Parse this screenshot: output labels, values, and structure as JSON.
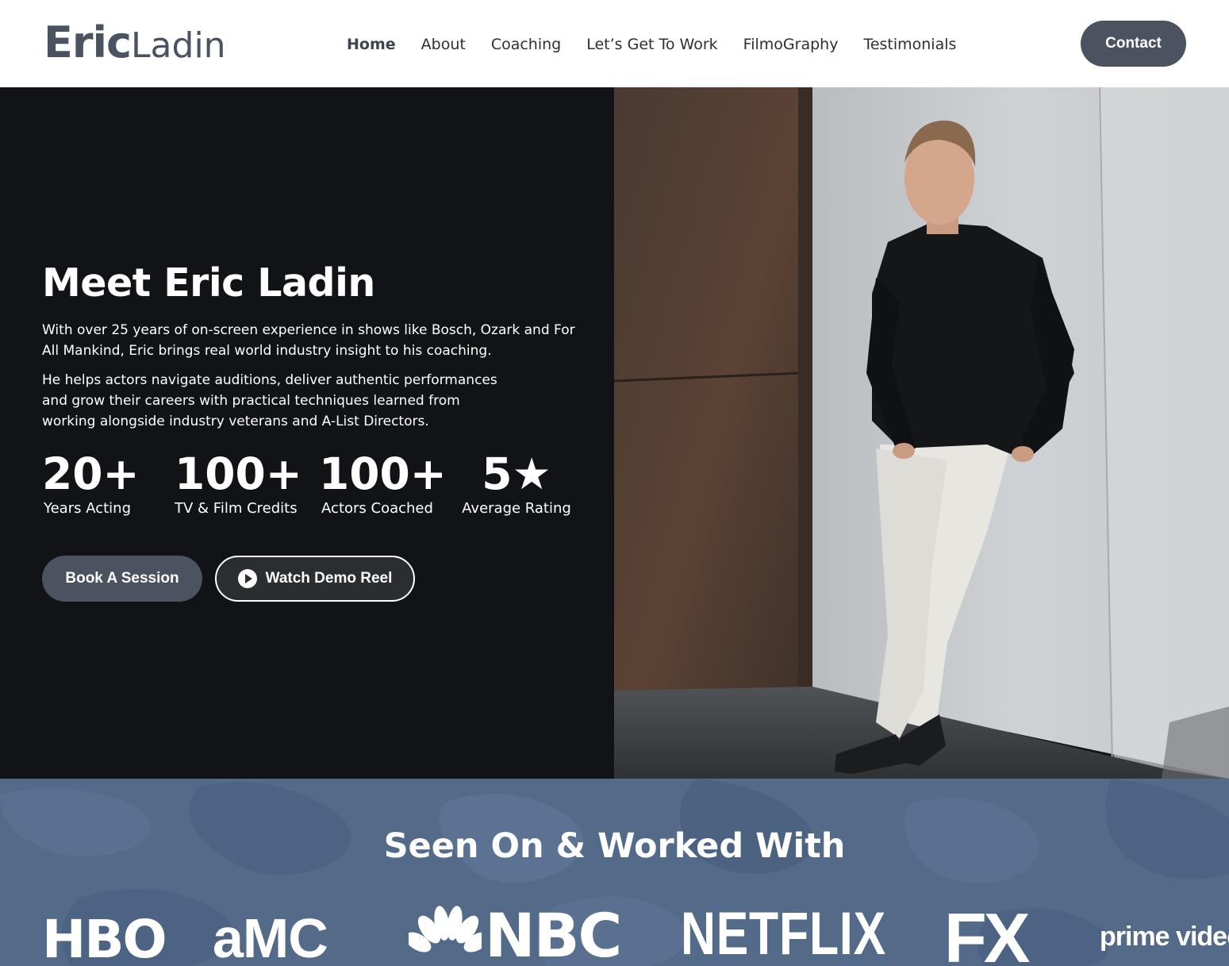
{
  "header": {
    "logo_first": "Eric",
    "logo_last": "Ladin",
    "nav": [
      {
        "label": "Home",
        "active": true
      },
      {
        "label": "About",
        "active": false
      },
      {
        "label": "Coaching",
        "active": false
      },
      {
        "label": "Let’s Get To Work",
        "active": false
      },
      {
        "label": "FilmoGraphy",
        "active": false
      },
      {
        "label": "Testimonials",
        "active": false
      }
    ],
    "contact_label": "Contact"
  },
  "hero": {
    "title": "Meet Eric Ladin",
    "paragraph_1": "With over 25 years of on-screen experience in shows like Bosch, Ozark and For All Mankind, Eric brings real world industry insight to his coaching.",
    "paragraph_2": "He helps actors navigate auditions, deliver authentic performances and grow their careers with practical techniques learned from working alongside industry veterans and A-List Directors.",
    "stats": [
      {
        "value": "20+",
        "label": "Years Acting"
      },
      {
        "value": "100+",
        "label": "TV & Film Credits"
      },
      {
        "value": "100+",
        "label": "Actors Coached"
      },
      {
        "value": "5★",
        "label": "Average Rating"
      }
    ],
    "book_label": "Book A Session",
    "demo_label": "Watch Demo Reel",
    "photo_icon": "portrait-photo"
  },
  "seen_on": {
    "title": "Seen On & Worked With",
    "brands": [
      "HBO",
      "aMC",
      "NBC",
      "NETFLIX",
      "FX",
      "prime video"
    ]
  },
  "colors": {
    "accent": "#4b5361",
    "hero_bg": "#111316",
    "band_bg": "#536a89",
    "white": "#ffffff"
  }
}
